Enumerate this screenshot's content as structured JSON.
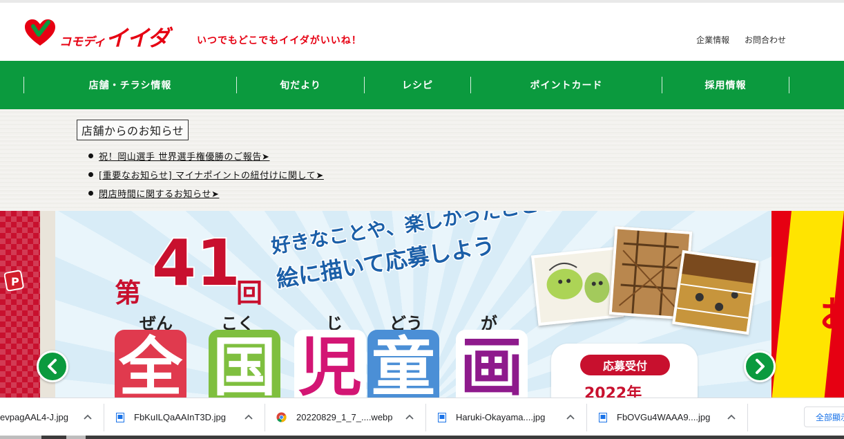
{
  "header": {
    "logo_small": "コモディ",
    "logo_big": "イイダ",
    "slogan": "いつでもどこでもイイダがいいね！",
    "links": [
      "企業情報",
      "お問合わせ"
    ]
  },
  "nav": {
    "items": [
      "店舗・チラシ情報",
      "旬だより",
      "レシピ",
      "ポイントカード",
      "採用情報"
    ]
  },
  "notice": {
    "title": "店舗からのお知らせ",
    "items": [
      "祝！岡山選手 世界選手権優勝のご報告➤",
      "[重要なお知らせ] マイナポイントの紐付けに関して➤",
      "閉店時間に関するお知らせ➤"
    ]
  },
  "banner": {
    "dai": "第",
    "number": "41",
    "kai": "回",
    "line1": "好きなことや、楽しかったことを",
    "line2": "絵に描いて応募しよう",
    "ruby": [
      "ぜん",
      "こく",
      "じ",
      "どう",
      "が"
    ],
    "title_chars": [
      "全",
      "国",
      "児",
      "童",
      "画"
    ],
    "accept_label": "応募受付",
    "accept_year": "2022年",
    "right_side_char": "お"
  },
  "downloads": {
    "items": [
      "evpagAAL4-J.jpg",
      "FbKuILQaAAInT3D.jpg",
      "20220829_1_7_....webp",
      "Haruki-Okayama....jpg",
      "FbOVGu4WAAA9....jpg"
    ],
    "show_all": "全部顯示"
  },
  "colors": {
    "brand_green": "#0b9a3e",
    "brand_red": "#e60012"
  }
}
